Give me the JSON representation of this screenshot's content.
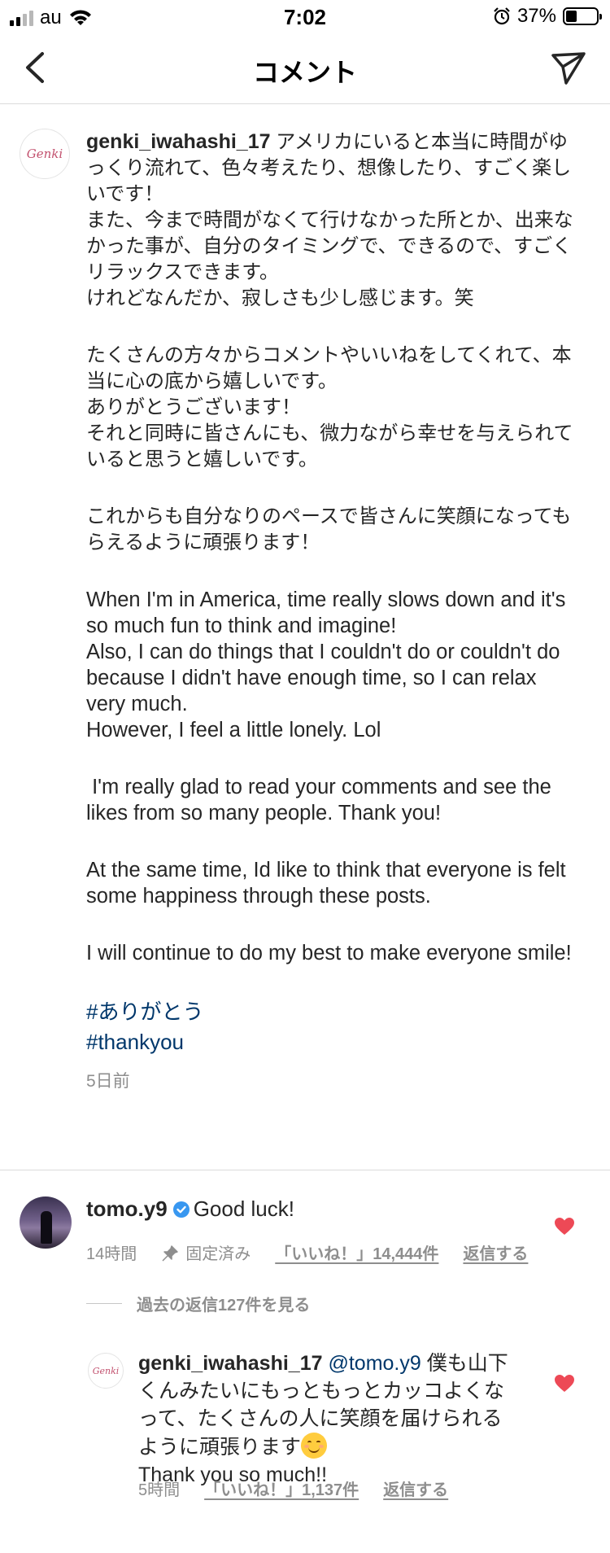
{
  "status_bar": {
    "carrier": "au",
    "time": "7:02",
    "battery_percent": "37%",
    "battery_level": 0.37
  },
  "header": {
    "title": "コメント",
    "back_icon": "chevron-left-icon",
    "send_icon": "paper-plane-icon"
  },
  "caption": {
    "avatar_text": "Genki",
    "username": "genki_iwahashi_17",
    "jp_lines": [
      "アメリカにいると本当に時間がゆっくり流れて、色々考えたり、想像したり、すごく楽しいです！",
      "また、今まで時間がなくて行けなかった所とか、出来なかった事が、自分のタイミングで、できるので、すごくリラックスできます。",
      "けれどなんだか、寂しさも少し感じます。笑",
      "たくさんの方々からコメントやいいねをしてくれて、本当に心の底から嬉しいです。",
      "ありがとうございます！",
      "それと同時に皆さんにも、微力ながら幸せを与えられていると思うと嬉しいです。",
      "これからも自分なりのペースで皆さんに笑顔になってもらえるように頑張ります！"
    ],
    "en_lines": [
      "When I'm in America, time really slows down and it's so much fun to think and imagine!",
      "Also, I can do things that I couldn't do or couldn't do because I didn't have enough time, so I can relax very much.",
      "However, I feel a little lonely.  Lol",
      " I'm really glad to read your comments and see the likes from so many people. Thank you!",
      "At the same time, Id like to think that everyone is felt some happiness through these posts.",
      "I will continue to do my best to make everyone smile!"
    ],
    "hashtags": [
      "#ありがとう",
      "#thankyou"
    ],
    "time": "5日前"
  },
  "comment": {
    "username": "tomo.y9",
    "verified": true,
    "text": "Good luck!",
    "time": "14時間",
    "pinned_label": "固定済み",
    "likes_label": "「いいね！」14,444件",
    "reply_label": "返信する",
    "liked": true,
    "heart_color": "#ed4956"
  },
  "view_replies_label": "過去の返信127件を見る",
  "reply": {
    "avatar_text": "Genki",
    "username": "genki_iwahashi_17",
    "mention": "@tomo.y9",
    "text_lines": [
      "僕も山下くんみたいにもっともっとカッコよくなって、たくさんの人に笑顔を届けられるように頑張ります"
    ],
    "text_after_emoji": "Thank you so much!!",
    "time": "5時間",
    "likes_label": "「いいね！」1,137件",
    "reply_label": "返信する",
    "liked": true
  },
  "colors": {
    "link": "#00376b",
    "muted": "#8e8e8e",
    "text": "#262626",
    "divider": "#dbdbdb",
    "verified": "#3897f0"
  }
}
